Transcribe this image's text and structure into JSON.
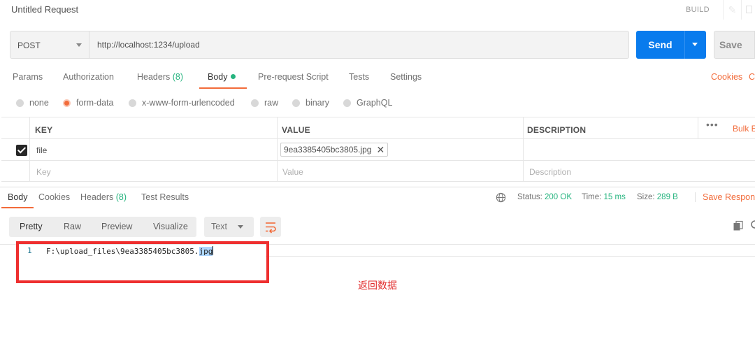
{
  "window": {
    "title": "Untitled Request",
    "build_label": "BUILD"
  },
  "request": {
    "method": "POST",
    "url": "http://localhost:1234/upload",
    "send_label": "Send",
    "save_label": "Save"
  },
  "request_tabs": [
    {
      "label": "Params"
    },
    {
      "label": "Authorization"
    },
    {
      "label": "Headers",
      "count": "(8)"
    },
    {
      "label": "Body"
    },
    {
      "label": "Pre-request Script"
    },
    {
      "label": "Tests"
    },
    {
      "label": "Settings"
    }
  ],
  "request_links": {
    "cookies": "Cookies",
    "code": "Co"
  },
  "body_types": {
    "none": "none",
    "form_data": "form-data",
    "urlencoded": "x-www-form-urlencoded",
    "raw": "raw",
    "binary": "binary",
    "graphql": "GraphQL",
    "selected": "form-data"
  },
  "params_table": {
    "headers": {
      "key": "KEY",
      "value": "VALUE",
      "description": "DESCRIPTION"
    },
    "more": "•••",
    "bulk_edit": "Bulk E",
    "rows": [
      {
        "checked": true,
        "key": "file",
        "value": "9ea3385405bc3805.jpg",
        "value_remove": "✕",
        "description": ""
      }
    ],
    "placeholders": {
      "key": "Key",
      "value": "Value",
      "description": "Description"
    }
  },
  "response_tabs": [
    {
      "label": "Body"
    },
    {
      "label": "Cookies"
    },
    {
      "label": "Headers",
      "count": "(8)"
    },
    {
      "label": "Test Results"
    }
  ],
  "response_meta": {
    "status_label": "Status:",
    "status_value": "200 OK",
    "time_label": "Time:",
    "time_value": "15 ms",
    "size_label": "Size:",
    "size_value": "289 B",
    "save_response": "Save Response"
  },
  "viewer": {
    "modes": [
      "Pretty",
      "Raw",
      "Preview",
      "Visualize"
    ],
    "format": "Text"
  },
  "response_body": {
    "line_number": "1",
    "text_plain": "F:\\upload_files\\9ea3385405bc3805.",
    "text_selected": "jpg"
  },
  "annotation": "返回数据",
  "colors": {
    "accent": "#f26b3a",
    "send_blue": "#097bed",
    "success_green": "#26b47f",
    "annotation_red": "#ee2f2f"
  }
}
